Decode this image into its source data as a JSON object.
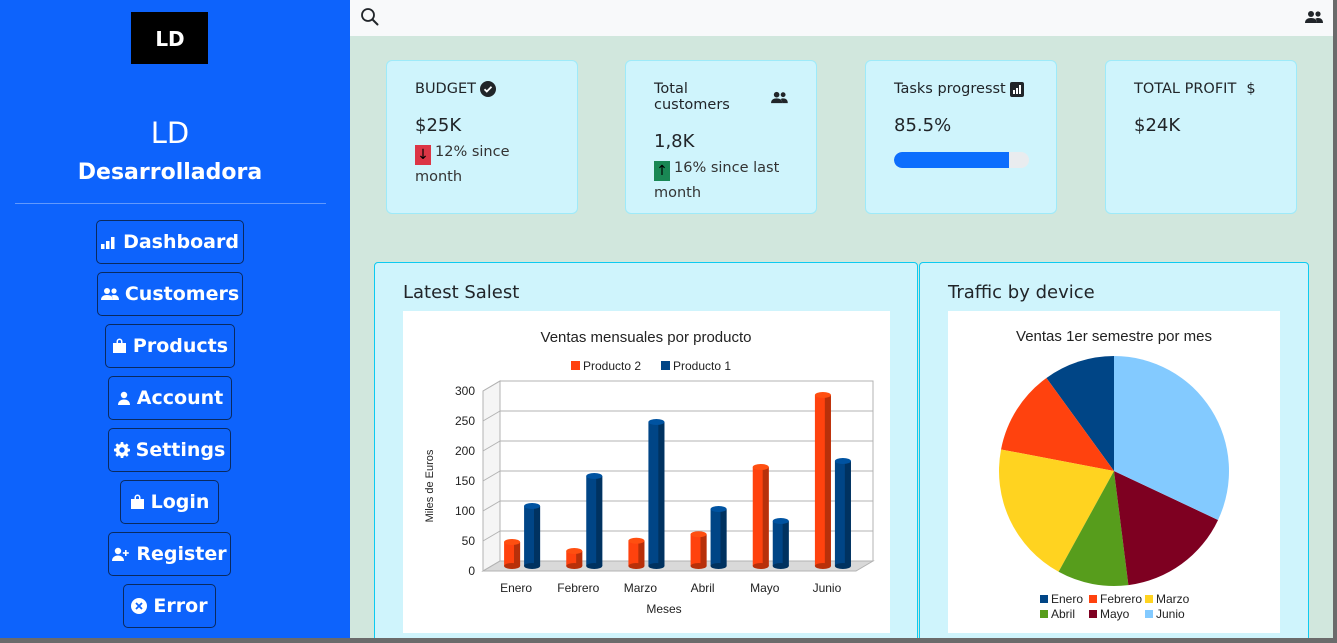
{
  "sidebar": {
    "logo_text": "LD",
    "brand_line1": "LD",
    "brand_line2": "Desarrolladora",
    "items": [
      {
        "label": "Dashboard",
        "icon": "bar-chart-icon"
      },
      {
        "label": "Customers",
        "icon": "users-icon"
      },
      {
        "label": "Products",
        "icon": "bag-icon"
      },
      {
        "label": "Account",
        "icon": "user-icon"
      },
      {
        "label": "Settings",
        "icon": "gear-icon"
      },
      {
        "label": "Login",
        "icon": "lock-icon"
      },
      {
        "label": "Register",
        "icon": "user-plus-icon"
      },
      {
        "label": "Error",
        "icon": "x-circle-icon"
      }
    ]
  },
  "topbar": {
    "search_icon": "search-icon",
    "right_icon": "users-icon"
  },
  "cards": [
    {
      "title": "BUDGET",
      "title_icon": "check-circle-icon",
      "value": "$25K",
      "note": "12% since month",
      "trend": "down"
    },
    {
      "title": "Total customers",
      "title_icon": "users-icon",
      "value": "1,8K",
      "note": "16% since last month",
      "trend": "up"
    },
    {
      "title": "Tasks progresst",
      "title_icon": "bar-chart-icon",
      "value": "85.5%",
      "progress": 0.855
    },
    {
      "title": "TOTAL PROFIT",
      "title_icon": "dollar-icon",
      "title_suffix": "$",
      "value": "$24K"
    }
  ],
  "panels": {
    "sales_title": "Latest Salest",
    "traffic_title": "Traffic by device"
  },
  "colors": {
    "sidebar_bg": "#0d63fc",
    "main_bg": "#d1e7dd",
    "card_bg": "#cff4fc",
    "down": "#dc3545",
    "up": "#198754",
    "progress": "#0d6efd"
  },
  "chart_data": [
    {
      "type": "bar",
      "title": "Ventas mensuales por producto",
      "xlabel": "Meses",
      "ylabel": "Miles de Euros",
      "categories": [
        "Enero",
        "Febrero",
        "Marzo",
        "Abril",
        "Mayo",
        "Junio"
      ],
      "series": [
        {
          "name": "Producto 2",
          "color": "#ff420e",
          "values": [
            40,
            25,
            42,
            53,
            165,
            285
          ]
        },
        {
          "name": "Producto 1",
          "color": "#004586",
          "values": [
            100,
            150,
            240,
            95,
            75,
            175
          ]
        }
      ],
      "ylim": [
        0,
        300
      ],
      "yticks": [
        0,
        50,
        100,
        150,
        200,
        250,
        300
      ],
      "legend": "top",
      "grid": false
    },
    {
      "type": "pie",
      "title": "Ventas 1er semestre por mes",
      "legend": "bottom",
      "slices": [
        {
          "label": "Enero",
          "value": 10,
          "color": "#004586"
        },
        {
          "label": "Febrero",
          "value": 12,
          "color": "#ff420e"
        },
        {
          "label": "Marzo",
          "value": 20,
          "color": "#ffd320"
        },
        {
          "label": "Abril",
          "value": 10,
          "color": "#579d1c"
        },
        {
          "label": "Mayo",
          "value": 16,
          "color": "#7e0021"
        },
        {
          "label": "Junio",
          "value": 32,
          "color": "#83caff"
        }
      ]
    }
  ]
}
